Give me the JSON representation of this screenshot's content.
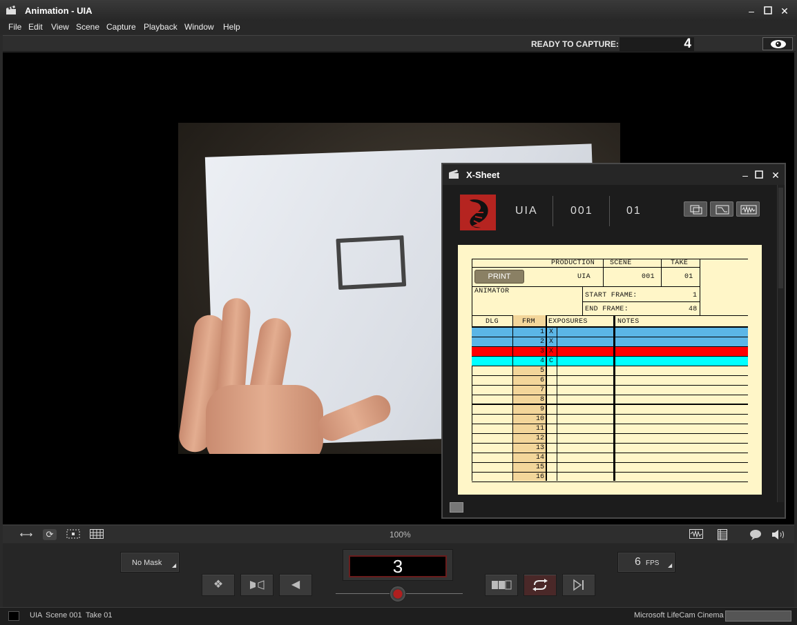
{
  "window": {
    "title": "Animation - UIA"
  },
  "menu": [
    "File",
    "Edit",
    "View",
    "Scene",
    "Capture",
    "Playback",
    "Window",
    "Help"
  ],
  "capture": {
    "status_label": "READY TO CAPTURE:",
    "count": "4"
  },
  "xsheet": {
    "title": "X-Sheet",
    "header": {
      "production": "UIA",
      "scene": "001",
      "take": "01"
    },
    "form": {
      "production_label": "PRODUCTION",
      "scene_label": "SCENE",
      "take_label": "TAKE",
      "print_label": "PRINT",
      "production": "UIA",
      "scene": "001",
      "take": "01",
      "animator_label": "ANIMATOR",
      "start_frame_label": "START FRAME:",
      "start_frame": "1",
      "end_frame_label": "END FRAME:",
      "end_frame": "48",
      "columns": {
        "dlg": "DLG",
        "frm": "FRM",
        "exposures": "EXPOSURES",
        "notes": "NOTES"
      }
    },
    "rows": [
      {
        "frame": "1",
        "exposure": "X",
        "color": "#5bb6e6"
      },
      {
        "frame": "2",
        "exposure": "X",
        "color": "#5bb6e6"
      },
      {
        "frame": "3",
        "exposure": "X",
        "color": "#ff0000"
      },
      {
        "frame": "4",
        "exposure": "C",
        "color": "#00ffff"
      },
      {
        "frame": "5",
        "exposure": "",
        "color": ""
      },
      {
        "frame": "6",
        "exposure": "",
        "color": ""
      },
      {
        "frame": "7",
        "exposure": "",
        "color": ""
      },
      {
        "frame": "8",
        "exposure": "",
        "color": ""
      },
      {
        "frame": "9",
        "exposure": "",
        "color": ""
      },
      {
        "frame": "10",
        "exposure": "",
        "color": ""
      },
      {
        "frame": "11",
        "exposure": "",
        "color": ""
      },
      {
        "frame": "12",
        "exposure": "",
        "color": ""
      },
      {
        "frame": "13",
        "exposure": "",
        "color": ""
      },
      {
        "frame": "14",
        "exposure": "",
        "color": ""
      },
      {
        "frame": "15",
        "exposure": "",
        "color": ""
      },
      {
        "frame": "16",
        "exposure": "",
        "color": ""
      }
    ]
  },
  "viewtoolbar": {
    "zoom": "100%"
  },
  "transport": {
    "mask": "No Mask",
    "frame": "3",
    "fps_value": "6",
    "fps_unit": "FPS"
  },
  "statusbar": {
    "project": "UIA",
    "scene": "Scene 001",
    "take": "Take 01",
    "camera": "Microsoft LifeCam Cinema"
  },
  "colors": {
    "accent_red": "#b01f1f",
    "sheet_paper": "#fff6c8",
    "frame_column": "#f3d69a"
  }
}
